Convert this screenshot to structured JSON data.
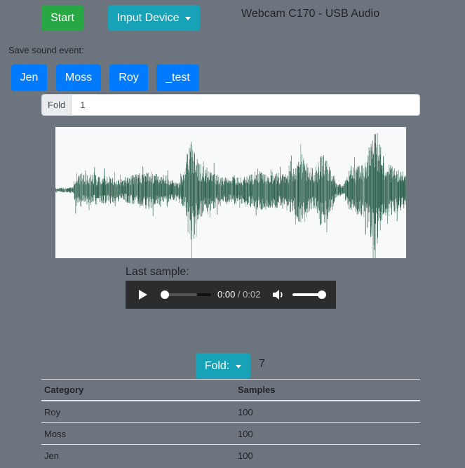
{
  "toolbar": {
    "start_label": "Start",
    "input_device_label": "Input Device",
    "device_name": "Webcam C170 - USB Audio"
  },
  "save_section": {
    "label": "Save sound event:",
    "buttons": [
      "Jen",
      "Moss",
      "Roy",
      "_test"
    ],
    "fold_addon": "Fold",
    "fold_value": "1"
  },
  "waveform": {
    "color": "#1e5640",
    "description": "audio waveform of last recorded sample"
  },
  "player": {
    "label": "Last sample:",
    "current_time": "0:00",
    "separator": " / ",
    "duration": "0:02",
    "progress": 0,
    "volume": 1.0
  },
  "fold_selector": {
    "label": "Fold:",
    "value": "7"
  },
  "table": {
    "headers": [
      "Category",
      "Samples"
    ],
    "rows": [
      [
        "Roy",
        "100"
      ],
      [
        "Moss",
        "100"
      ],
      [
        "Jen",
        "100"
      ]
    ]
  },
  "colors": {
    "background": "#6c757d",
    "success": "#28a745",
    "info": "#17a2b8",
    "primary": "#007bff"
  }
}
